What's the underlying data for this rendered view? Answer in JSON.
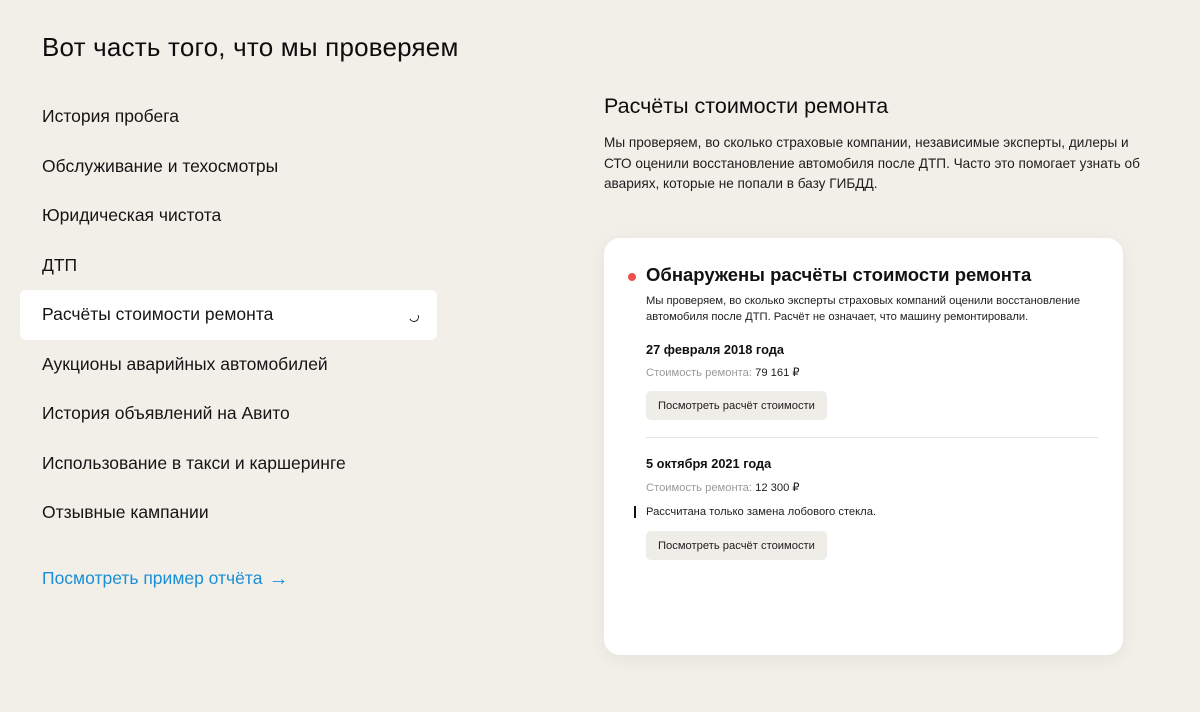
{
  "page": {
    "title": "Вот часть того, что мы проверяем"
  },
  "nav": {
    "items": [
      {
        "label": "История пробега",
        "active": false
      },
      {
        "label": "Обслуживание и техосмотры",
        "active": false
      },
      {
        "label": "Юридическая чистота",
        "active": false
      },
      {
        "label": "ДТП",
        "active": false
      },
      {
        "label": "Расчёты стоимости ремонта",
        "active": true
      },
      {
        "label": "Аукционы аварийных автомобилей",
        "active": false
      },
      {
        "label": "История объявлений на Авито",
        "active": false
      },
      {
        "label": "Использование в такси и каршеринге",
        "active": false
      },
      {
        "label": "Отзывные кампании",
        "active": false
      }
    ],
    "example_link": "Посмотреть пример отчёта",
    "example_arrow": "→"
  },
  "section": {
    "title": "Расчёты стоимости ремонта",
    "description": "Мы проверяем, во сколько страховые компании, независимые эксперты, дилеры и СТО оценили восстановление автомобиля после ДТП. Часто это помогает узнать об авариях, которые не попали в базу ГИБДД."
  },
  "card": {
    "title": "Обнаружены расчёты стоимости ремонта",
    "status_color": "#ee4e4e",
    "description": "Мы проверяем, во сколько эксперты страховых компаний оценили восстановление автомобиля после ДТП. Расчёт не означает, что машину ремонтировали.",
    "entries": [
      {
        "date": "27 февраля 2018 года",
        "cost_label": "Стоимость ремонта:",
        "cost_value": "79 161 ₽",
        "note": "",
        "button": "Посмотреть расчёт стоимости"
      },
      {
        "date": "5 октября 2021 года",
        "cost_label": "Стоимость ремонта:",
        "cost_value": "12 300 ₽",
        "note": "Рассчитана только замена лобового стекла.",
        "button": "Посмотреть расчёт стоимости"
      }
    ]
  },
  "colors": {
    "background": "#f2efe9",
    "link": "#1a8fd6",
    "button_bg": "#efede8"
  }
}
